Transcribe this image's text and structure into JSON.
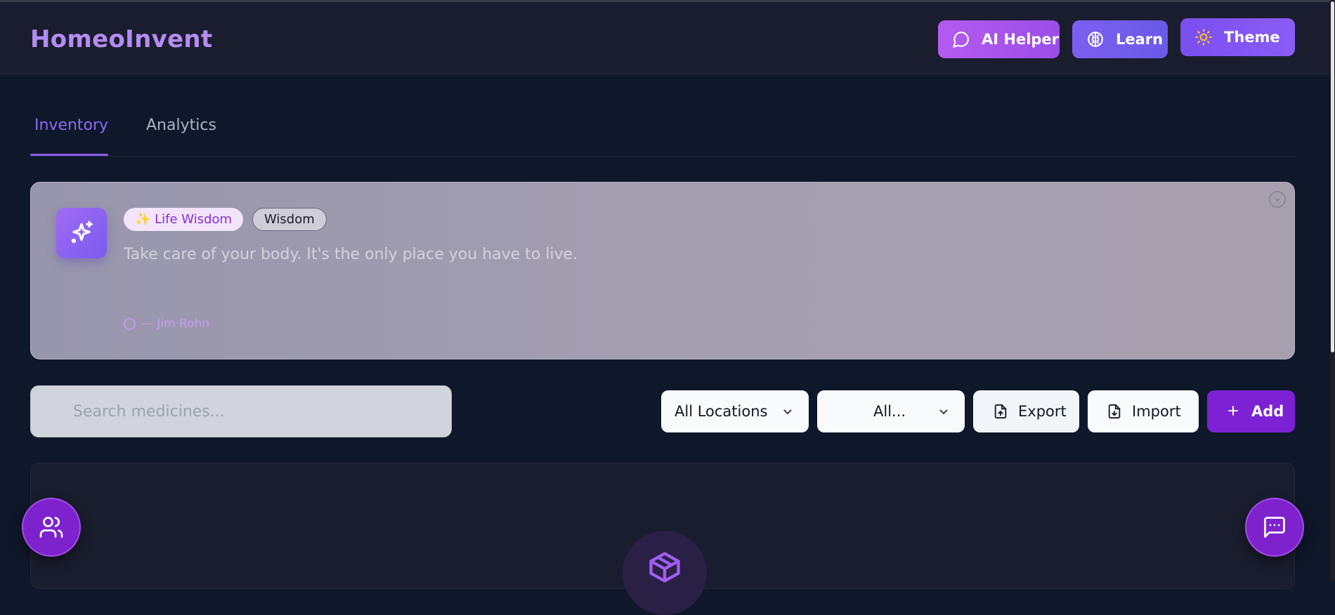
{
  "header": {
    "brand": "HomeoInvent",
    "buttons": {
      "ai_helper": "AI Helper",
      "learn": "Learn",
      "theme": "Theme"
    }
  },
  "tabs": [
    {
      "label": "Inventory",
      "active": true
    },
    {
      "label": "Analytics",
      "active": false
    }
  ],
  "wisdom_card": {
    "tag_primary": "✨ Life Wisdom",
    "tag_secondary": "Wisdom",
    "quote": "Take care of your body. It's the only place you have to live.",
    "author": "— Jim Rohn"
  },
  "toolbar": {
    "search_placeholder": "Search medicines...",
    "location_select": "All Locations",
    "category_select": "All...",
    "export_label": "Export",
    "import_label": "Import",
    "add_label": "Add"
  },
  "icons": {
    "ai_helper": "chat-bubble-icon",
    "learn": "brain-icon",
    "theme": "sun-icon",
    "wisdom": "sparkles-icon",
    "empty_state": "package-icon",
    "fab_left": "users-icon",
    "fab_right": "message-square-icon"
  },
  "colors": {
    "background": "#0f172a",
    "brand": "#b48cf2",
    "accent": "#7c22d4",
    "tab_active": "#8b6cf6"
  }
}
